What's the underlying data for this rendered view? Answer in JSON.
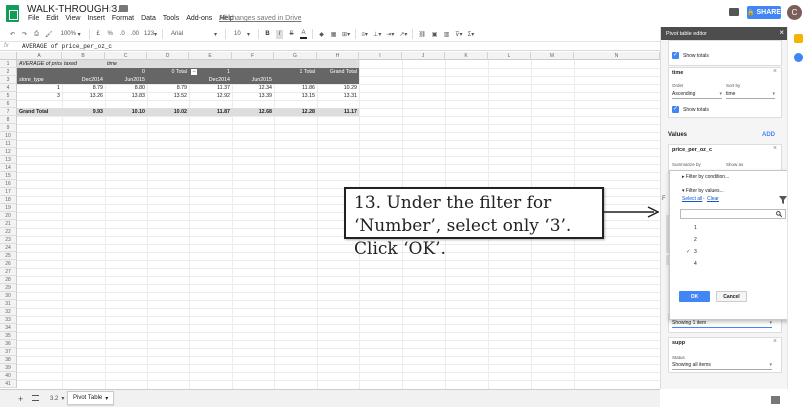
{
  "app": {
    "doc_title": "WALK-THROUGH 3.2",
    "saved_status": "All changes saved in Drive",
    "share_label": "SHARE",
    "avatar_initial": "C"
  },
  "menu": [
    "File",
    "Edit",
    "View",
    "Insert",
    "Format",
    "Data",
    "Tools",
    "Add-ons",
    "Help"
  ],
  "toolbar": {
    "zoom": "100%",
    "currency": "£",
    "percent": "%",
    "dec_less": ".0",
    "dec_more": ".00",
    "format_more": "123",
    "font": "Arial",
    "font_size": "10",
    "bold": "B",
    "italic": "I",
    "strike": "S",
    "text_color": "A"
  },
  "formula_bar": {
    "fx": "fx",
    "content": "AVERAGE of price_per_oz_c"
  },
  "grid": {
    "columns": [
      "A",
      "B",
      "C",
      "D",
      "E",
      "F",
      "G",
      "H",
      "I",
      "J",
      "K",
      "L",
      "M",
      "N"
    ],
    "rows": [
      "1",
      "2",
      "3",
      "4",
      "5",
      "6",
      "7",
      "8",
      "9",
      "10",
      "11",
      "12",
      "13",
      "14",
      "15",
      "16",
      "17",
      "18",
      "19",
      "20",
      "21",
      "22",
      "23",
      "24",
      "25",
      "26",
      "27",
      "28",
      "29",
      "30",
      "31",
      "32",
      "33",
      "34",
      "35",
      "36",
      "37",
      "38",
      "39",
      "40",
      "41"
    ],
    "pivot": {
      "r1_a": "AVERAGE of price_per_oz_c",
      "r1_b": "taxed",
      "r1_c": "time",
      "r2_b": "0",
      "r2_d": "0 Total",
      "r2_e": "1",
      "r2_g": "1 Total",
      "r2_h": "Grand Total",
      "r3_a": "store_type",
      "r3_b": "Dec2014",
      "r3_c": "Jun2015",
      "r3_e": "Dec2014",
      "r3_f": "Jun2015",
      "rows": [
        {
          "label": "1",
          "values": [
            "8.79",
            "8.80",
            "8.79",
            "11.37",
            "12.34",
            "11.86",
            "10.29"
          ]
        },
        {
          "label": "3",
          "values": [
            "13.26",
            "13.83",
            "13.52",
            "12.92",
            "13.39",
            "13.15",
            "13.31"
          ]
        },
        {
          "label": "Grand Total",
          "values": [
            "9.93",
            "10.10",
            "10.02",
            "11.87",
            "12.68",
            "12.28",
            "11.17"
          ]
        }
      ]
    }
  },
  "sheet_tabs": {
    "add": "+",
    "tabs": [
      "3.2",
      "Pivot Table"
    ]
  },
  "panel": {
    "title": "Pivot table editor",
    "close": "×",
    "top_show_totals": "Show totals",
    "time_card": {
      "title": "time",
      "order_label": "Order",
      "order_value": "Ascending",
      "sort_label": "Sort by",
      "sort_value": "time",
      "show_totals": "Show totals"
    },
    "values_heading": "Values",
    "values_add": "ADD",
    "price_card": {
      "title": "price_per_oz_c",
      "summarize_label": "Summarize by",
      "show_as_label": "Show as"
    },
    "filters_letter": "F",
    "number_card": {
      "status_value": "Showing 1 item"
    },
    "supp_card": {
      "title": "supp",
      "status_label": "Status",
      "status_value": "Showing all items"
    }
  },
  "filter_popup": {
    "by_condition": "Filter by condition...",
    "by_values": "Filter by values...",
    "select_all": "Select all",
    "separator": "-",
    "clear": "Clear",
    "options": [
      {
        "label": "1",
        "checked": false
      },
      {
        "label": "2",
        "checked": false
      },
      {
        "label": "3",
        "checked": true
      },
      {
        "label": "4",
        "checked": false
      }
    ],
    "ok": "OK",
    "cancel": "Cancel"
  },
  "annotation": {
    "text": "13. Under the filter for ‘Number’, select only ‘3’. Click ‘OK’."
  },
  "colors": {
    "accent": "#4285f4",
    "sheets_green": "#0f9d58",
    "pivot_dark": "#666666",
    "pivot_gray": "#dddddd"
  }
}
